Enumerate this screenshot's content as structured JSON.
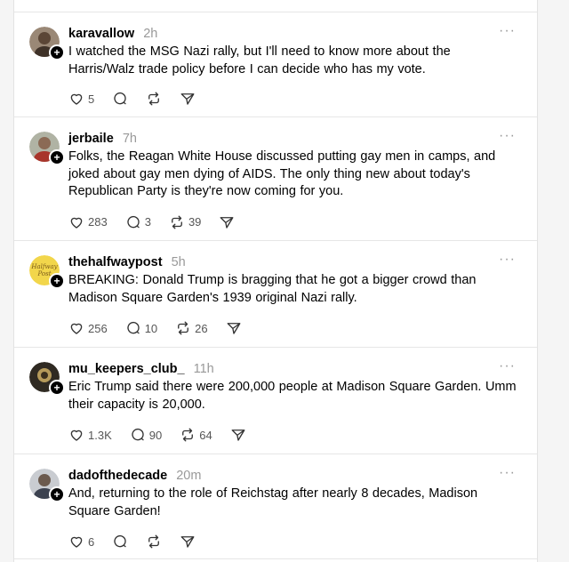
{
  "posts": [
    {
      "username": "karavallow",
      "time": "2h",
      "text": "I watched the MSG Nazi rally, but I'll need to know more about the Harris/Walz trade policy before I can decide who has my vote.",
      "likes": "5",
      "replies": "",
      "reposts": "",
      "avatar_color": "#7a6a5a"
    },
    {
      "username": "jerbaile",
      "time": "7h",
      "text": "Folks, the Reagan White House discussed putting gay men in camps, and joked about gay men dying of AIDS. The only thing new about today's Republican Party is they're now coming for you.",
      "likes": "283",
      "replies": "3",
      "reposts": "39",
      "avatar_color": "#8c8c7a"
    },
    {
      "username": "thehalfwaypost",
      "time": "5h",
      "text": "BREAKING: Donald Trump is bragging that he got a bigger crowd than Madison Square Garden's 1939 original Nazi rally.",
      "likes": "256",
      "replies": "10",
      "reposts": "26",
      "avatar_color": "#f2d64b"
    },
    {
      "username": "mu_keepers_club_",
      "time": "11h",
      "text": "Eric Trump said there were 200,000 people at Madison Square Garden. Umm their capacity is 20,000.",
      "likes": "1.3K",
      "replies": "90",
      "reposts": "64",
      "avatar_color": "#3a3428"
    },
    {
      "username": "dadofthedecade",
      "time": "20m",
      "text": "And, returning to the role of Reichstag after nearly 8 decades, Madison Square Garden!",
      "likes": "6",
      "replies": "",
      "reposts": "",
      "avatar_color": "#5e6470"
    }
  ],
  "icons": {
    "more": "more-icon",
    "like": "heart-icon",
    "reply": "comment-icon",
    "repost": "repost-icon",
    "share": "send-icon",
    "follow": "plus-icon"
  }
}
